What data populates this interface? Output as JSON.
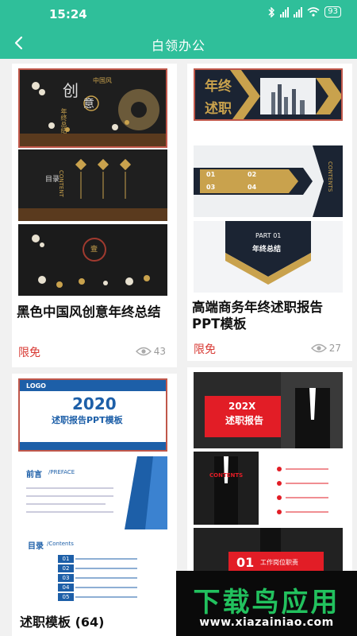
{
  "status_bar": {
    "time": "15:24",
    "battery": "93",
    "icons": [
      "bluetooth-icon",
      "signal-icon",
      "signal-icon",
      "wifi-icon",
      "battery-icon"
    ]
  },
  "header": {
    "title": "白领办公",
    "back_icon": "chevron-left-icon"
  },
  "cards": [
    {
      "thumbnail_text": [
        "中国风",
        "创",
        "意",
        "年终总结",
        "CONTENT",
        "目录",
        "壹"
      ],
      "title": "黑色中国风创意年终总结",
      "badge": "限免",
      "views": "43"
    },
    {
      "thumbnail_text": [
        "年终",
        "述职",
        "01",
        "02",
        "03",
        "04",
        "CONTENTS",
        "PART 01",
        "年终总结"
      ],
      "title": "高端商务年终述职报告PPT模板",
      "badge": "限免",
      "views": "27"
    },
    {
      "thumbnail_text": [
        "LOGO",
        "2020",
        "述职报告PPT模板",
        "前言",
        "/PREFACE",
        "目录",
        "/Contents",
        "01",
        "02",
        "03",
        "04",
        "05"
      ],
      "title": "述职模板 (64)"
    },
    {
      "thumbnail_text": [
        "202X",
        "述职报告",
        "CONTENTS",
        "01",
        "工作岗位职责"
      ]
    }
  ],
  "watermark": {
    "title": "下载鸟应用",
    "url": "www.xiazainiao.com"
  },
  "colors": {
    "brand": "#2fbf9a",
    "badge": "#d83a34",
    "watermark_green": "#22c15e"
  }
}
